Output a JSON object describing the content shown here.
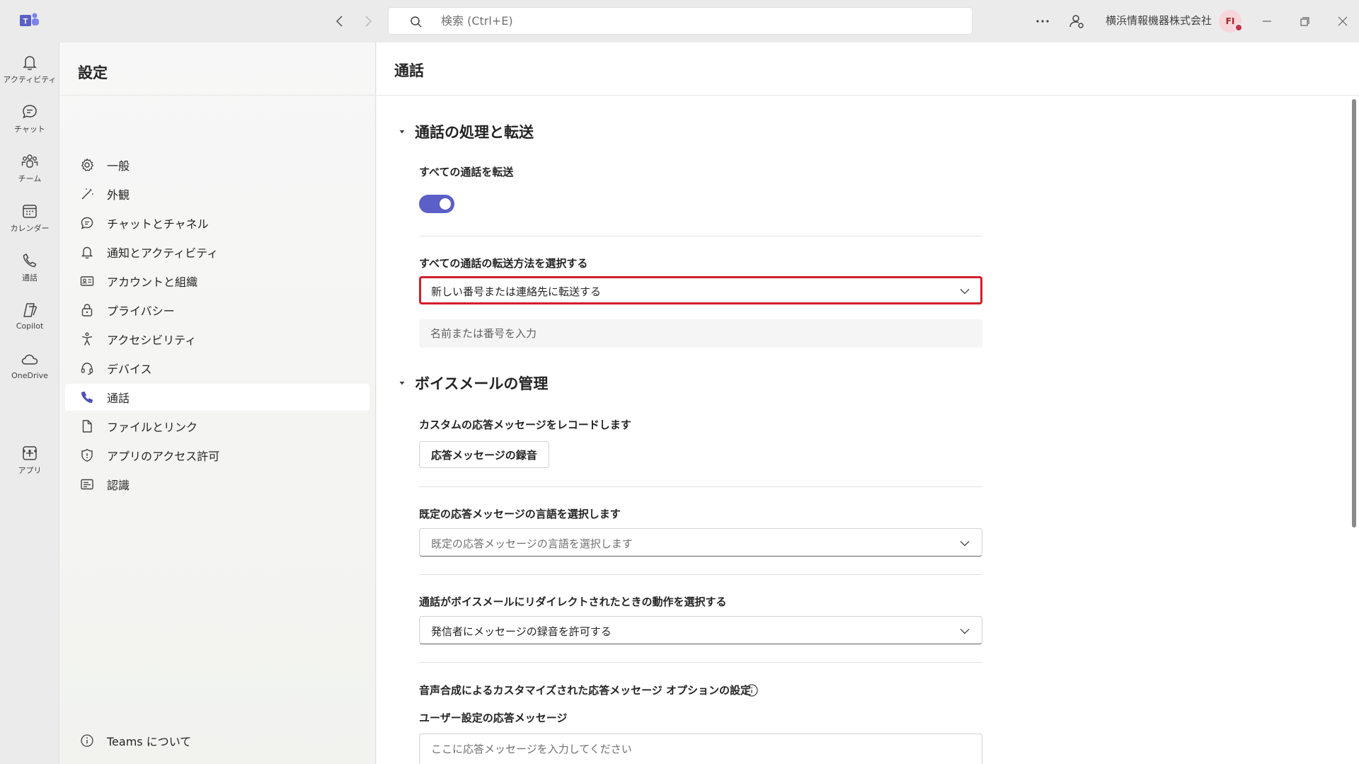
{
  "titlebar": {
    "search_placeholder": "検索 (Ctrl+E)",
    "org_name": "横浜情報機器株式会社",
    "avatar_initials": "FI"
  },
  "rail": {
    "items": [
      {
        "label": "アクティビティ",
        "icon": "bell-icon"
      },
      {
        "label": "チャット",
        "icon": "chat-icon"
      },
      {
        "label": "チーム",
        "icon": "teams-icon"
      },
      {
        "label": "カレンダー",
        "icon": "calendar-icon"
      },
      {
        "label": "通話",
        "icon": "phone-icon"
      },
      {
        "label": "Copilot",
        "icon": "copilot-icon"
      },
      {
        "label": "OneDrive",
        "icon": "cloud-icon"
      },
      {
        "label": "アプリ",
        "icon": "add-app-icon"
      }
    ]
  },
  "settings": {
    "title": "設定",
    "items": [
      {
        "label": "一般",
        "icon": "gear-icon"
      },
      {
        "label": "外観",
        "icon": "wand-icon"
      },
      {
        "label": "チャットとチャネル",
        "icon": "chat-icon"
      },
      {
        "label": "通知とアクティビティ",
        "icon": "bell-icon"
      },
      {
        "label": "アカウントと組織",
        "icon": "id-card-icon"
      },
      {
        "label": "プライバシー",
        "icon": "lock-icon"
      },
      {
        "label": "アクセシビリティ",
        "icon": "accessibility-icon"
      },
      {
        "label": "デバイス",
        "icon": "headset-icon"
      },
      {
        "label": "通話",
        "icon": "phone-icon",
        "selected": true
      },
      {
        "label": "ファイルとリンク",
        "icon": "file-icon"
      },
      {
        "label": "アプリのアクセス許可",
        "icon": "shield-icon"
      },
      {
        "label": "認識",
        "icon": "text-box-icon"
      }
    ],
    "about": "Teams について"
  },
  "main": {
    "title": "通話",
    "section1": {
      "heading": "通話の処理と転送",
      "forward_all_label": "すべての通話を転送",
      "forward_toggle": "on",
      "method_label": "すべての通話の転送方法を選択する",
      "method_value": "新しい番号または連絡先に転送する",
      "target_placeholder": "名前または番号を入力"
    },
    "section2": {
      "heading": "ボイスメールの管理",
      "record_label": "カスタムの応答メッセージをレコードします",
      "record_button": "応答メッセージの録音",
      "language_label": "既定の応答メッセージの言語を選択します",
      "language_placeholder": "既定の応答メッセージの言語を選択します",
      "redirect_label": "通話がボイスメールにリダイレクトされたときの動作を選択する",
      "redirect_value": "発信者にメッセージの録音を許可する",
      "tts_label": "音声合成によるカスタマイズされた応答メッセージ オプションの設定",
      "user_greeting_label": "ユーザー設定の応答メッセージ",
      "user_greeting_placeholder": "ここに応答メッセージを入力してください"
    }
  },
  "colors": {
    "accent": "#5b5fc7",
    "highlight": "#d21f2a"
  }
}
